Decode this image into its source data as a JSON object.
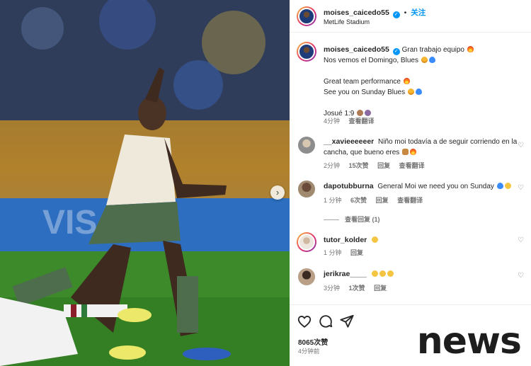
{
  "post": {
    "username": "moises_caicedo55",
    "separator": "•",
    "follow_label": "关注",
    "location": "MetLife Stadium"
  },
  "caption": {
    "username": "moises_caicedo55",
    "line1": "Gran trabajo equipo",
    "line2": "Nos vemos el Domingo, Blues",
    "line3": "Great team performance",
    "line4": "See you on Sunday Blues",
    "line5": "Josué 1:9",
    "time": "4分钟",
    "translate": "查看翻译"
  },
  "comments": [
    {
      "username": "__xavieeeeeer",
      "text_line1": "Niño moi todavía a de seguir corriendo en la",
      "text_line2": "cancha, que bueno eres",
      "time": "2分钟",
      "likes": "15次赞",
      "reply": "回复",
      "translate": "查看翻译"
    },
    {
      "username": "dapotubburna",
      "text_line1": "General Moi we need you on Sunday",
      "time": "1 分钟",
      "likes": "6次赞",
      "reply": "回复",
      "translate": "查看翻译",
      "view_replies": "查看回复 (1)"
    },
    {
      "username": "tutor_kolder",
      "time": "1 分钟",
      "reply": "回复"
    },
    {
      "username": "jerikrae____",
      "time": "3分钟",
      "likes": "1次赞",
      "reply": "回复"
    }
  ],
  "footer": {
    "likes": "8065次赞",
    "posted": "4分钟前"
  },
  "watermark": "news",
  "icons": {
    "like": "heart-icon",
    "comment": "comment-icon",
    "share": "share-icon",
    "next": "chevron-right-icon",
    "verified": "verified-badge-icon"
  },
  "colors": {
    "accent": "#0095f6",
    "text": "#262626",
    "secondary": "#737373"
  }
}
